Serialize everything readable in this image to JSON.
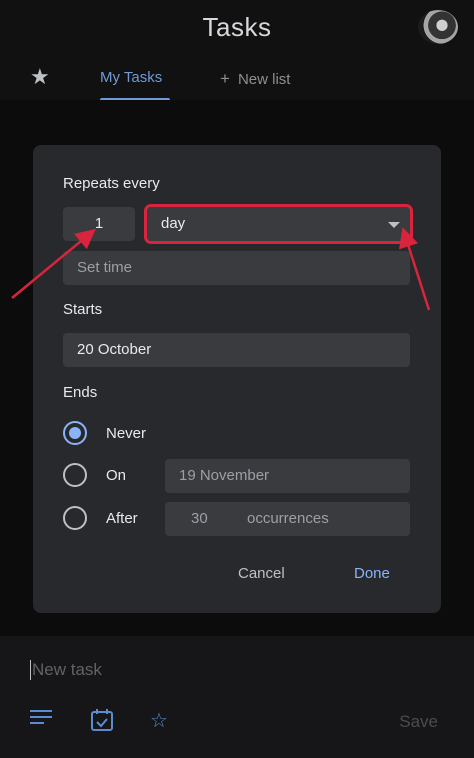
{
  "app": {
    "title": "Tasks"
  },
  "tabs": {
    "my_tasks": "My Tasks",
    "new_list": "New list"
  },
  "dialog": {
    "repeats_label": "Repeats every",
    "interval_value": "1",
    "interval_unit": "day",
    "set_time_placeholder": "Set time",
    "starts_label": "Starts",
    "starts_value": "20 October",
    "ends_label": "Ends",
    "ends_options": {
      "never": "Never",
      "on": "On",
      "after": "After"
    },
    "ends_selected": "never",
    "on_date": "19 November",
    "after_count": "30",
    "after_unit": "occurrences",
    "cancel_label": "Cancel",
    "done_label": "Done"
  },
  "bottom": {
    "new_task_placeholder": "New task",
    "save_label": "Save"
  },
  "colors": {
    "accent": "#8ab4f8",
    "annotation": "#d8253d",
    "dialog_bg": "#28292c"
  }
}
